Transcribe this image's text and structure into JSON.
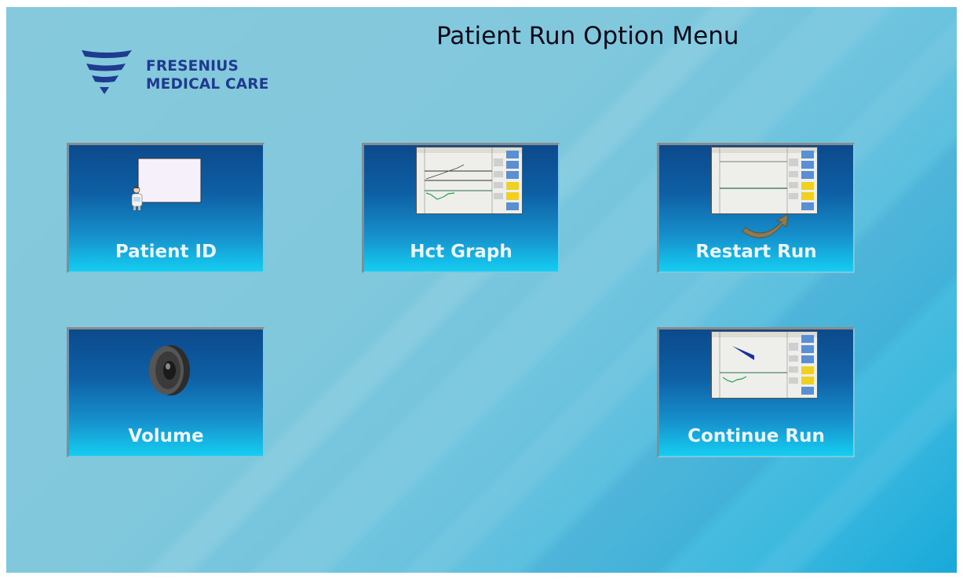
{
  "header": {
    "title": "Patient Run Option Menu"
  },
  "logo": {
    "line1": "FRESENIUS",
    "line2": "MEDICAL CARE",
    "icon": "fresenius-logo-icon",
    "color": "#1f3a8f"
  },
  "menu": {
    "patient_id": {
      "label": "Patient ID",
      "icon": "patient-id-icon"
    },
    "hct_graph": {
      "label": "Hct Graph",
      "icon": "hct-graph-thumbnail-icon"
    },
    "restart_run": {
      "label": "Restart Run",
      "icon": "restart-run-thumbnail-icon"
    },
    "volume": {
      "label": "Volume",
      "icon": "speaker-icon"
    },
    "continue_run": {
      "label": "Continue Run",
      "icon": "continue-run-thumbnail-icon"
    }
  },
  "colors": {
    "background": "#82c8dc",
    "tile_top": "#0b4a8c",
    "tile_bottom": "#15cdf1",
    "tile_label": "#eaf6fb",
    "title_text": "#0a0a1a"
  }
}
